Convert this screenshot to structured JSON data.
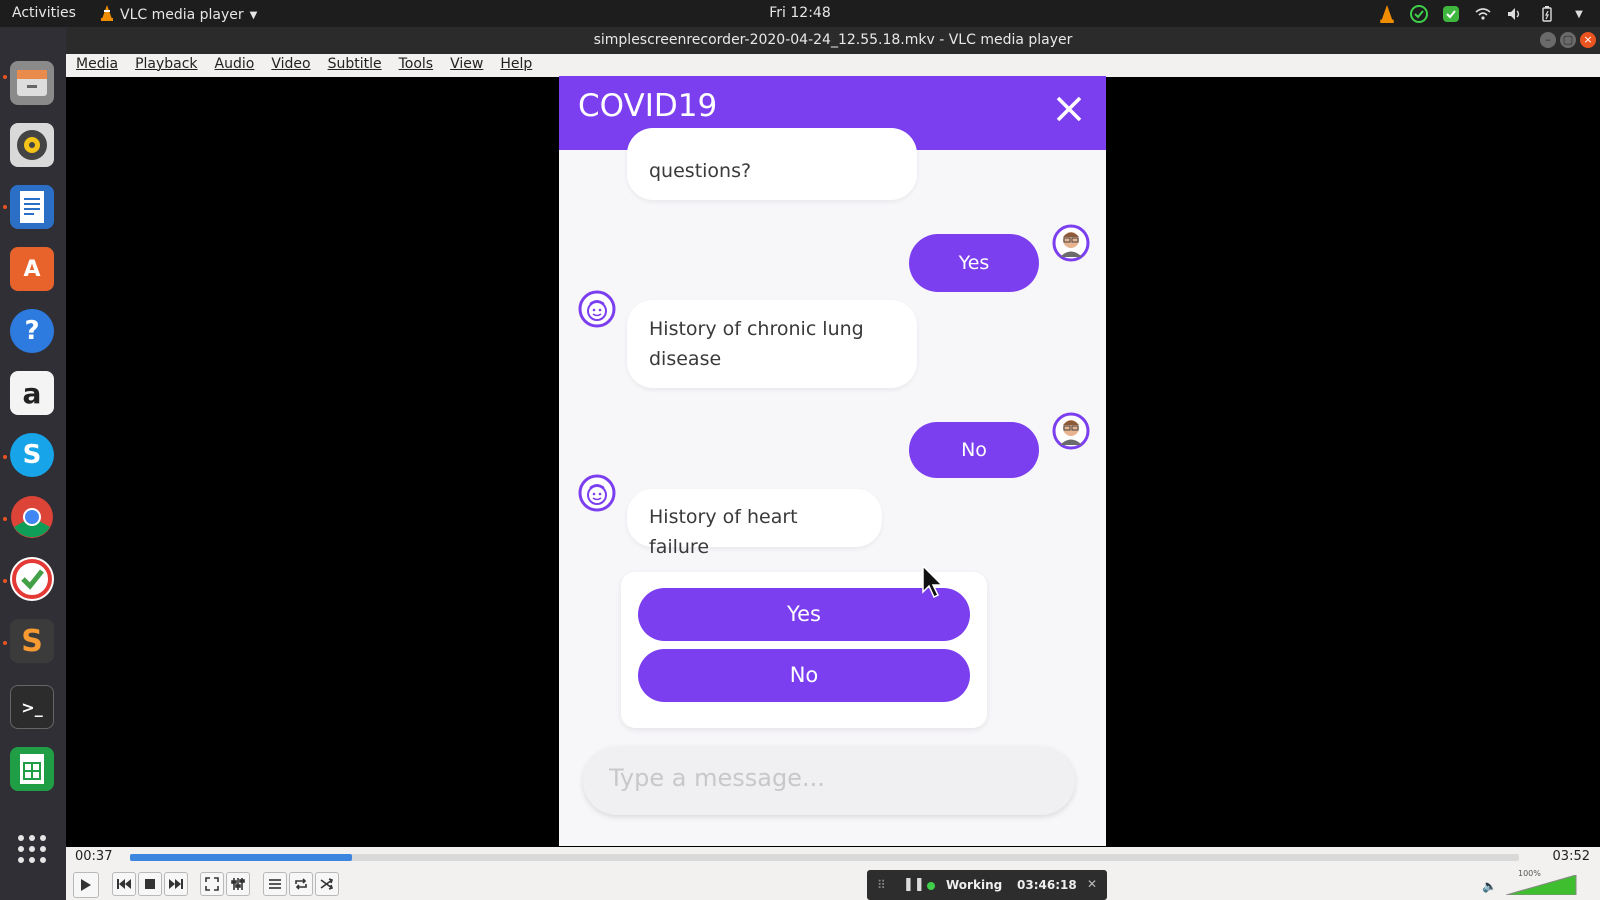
{
  "topbar": {
    "activities": "Activities",
    "app_name": "VLC media player",
    "clock": "Fri 12:48"
  },
  "window": {
    "title": "simplescreenrecorder-2020-04-24_12.55.18.mkv - VLC media player"
  },
  "menu": [
    "Media",
    "Playback",
    "Audio",
    "Video",
    "Subtitle",
    "Tools",
    "View",
    "Help"
  ],
  "chat": {
    "title": "COVID19",
    "messages": [
      {
        "from": "bot",
        "text": "questions?"
      },
      {
        "from": "user",
        "text": "Yes"
      },
      {
        "from": "bot",
        "text": "History of chronic lung disease"
      },
      {
        "from": "user",
        "text": "No"
      },
      {
        "from": "bot",
        "text": "History of heart failure"
      }
    ],
    "choices": [
      "Yes",
      "No"
    ],
    "input_placeholder": "Type a message..."
  },
  "player": {
    "elapsed": "00:37",
    "total": "03:52",
    "progress_fraction": 0.16,
    "volume_label": "100%",
    "accent_color": "#7b3ff0"
  },
  "recorder": {
    "status": "Working",
    "time": "03:46:18"
  }
}
